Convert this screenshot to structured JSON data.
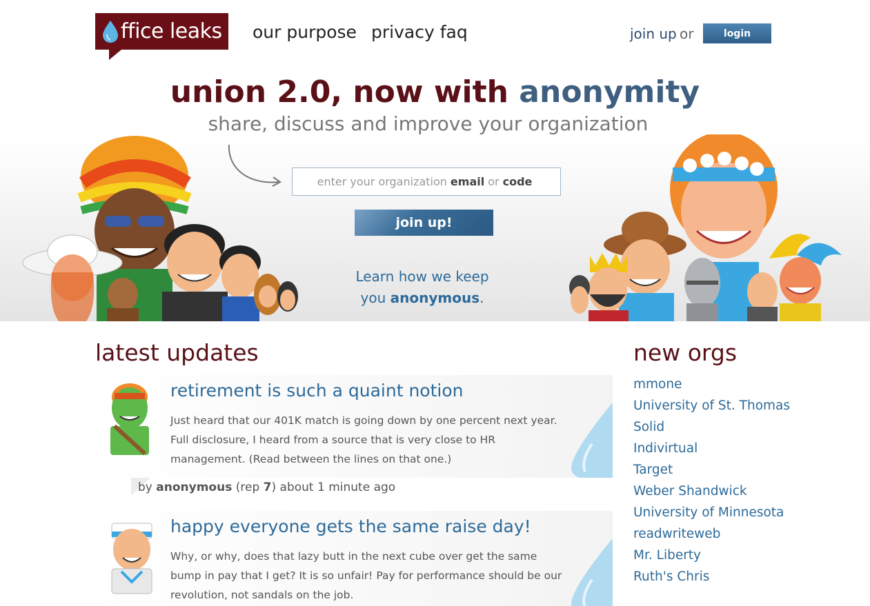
{
  "header": {
    "logo_text": "ffice leaks",
    "nav": [
      "our purpose",
      "privacy faq"
    ],
    "join_link": "join up",
    "or_text": "or",
    "login_label": "login"
  },
  "hero": {
    "headline_part1": "union 2.0, now with",
    "headline_part2": "anonymity",
    "subline": "share, discuss and improve your organization",
    "input_placeholder_prefix": "enter your organization",
    "input_placeholder_email": "email",
    "input_placeholder_or": "or",
    "input_placeholder_code": "code",
    "join_button": "join up!",
    "learn_line1": "Learn how we keep",
    "learn_line2_prefix": "you",
    "learn_line2_bold": "anonymous",
    "learn_line2_suffix": "."
  },
  "updates": {
    "title": "latest updates",
    "posts": [
      {
        "title": "retirement is such a quaint notion",
        "body": "Just heard that our 401K match is going down by one percent next year. Full disclosure, I heard from a source that is very close to HR management. (Read between the lines on that one.)",
        "by": "by",
        "author": "anonymous",
        "rep_prefix": "(rep",
        "rep": "7",
        "rep_suffix": ")",
        "time": "about 1 minute ago"
      },
      {
        "title": "happy everyone gets the same raise day!",
        "body": "Why, or why, does that lazy butt in the next cube over get the same bump in pay that I get? It is so unfair! Pay for performance should be our revolution, not sandals on the job."
      }
    ]
  },
  "new_orgs": {
    "title": "new orgs",
    "items": [
      "mmone",
      "University of St. Thomas",
      "Solid",
      "Indivirtual",
      "Target",
      "Weber Shandwick",
      "University of Minnesota",
      "readwriteweb",
      "Mr. Liberty",
      "Ruth's Chris"
    ]
  },
  "colors": {
    "brand_maroon": "#5a1016",
    "link_blue": "#2d6a99",
    "button_blue": "#2e5f8a"
  }
}
